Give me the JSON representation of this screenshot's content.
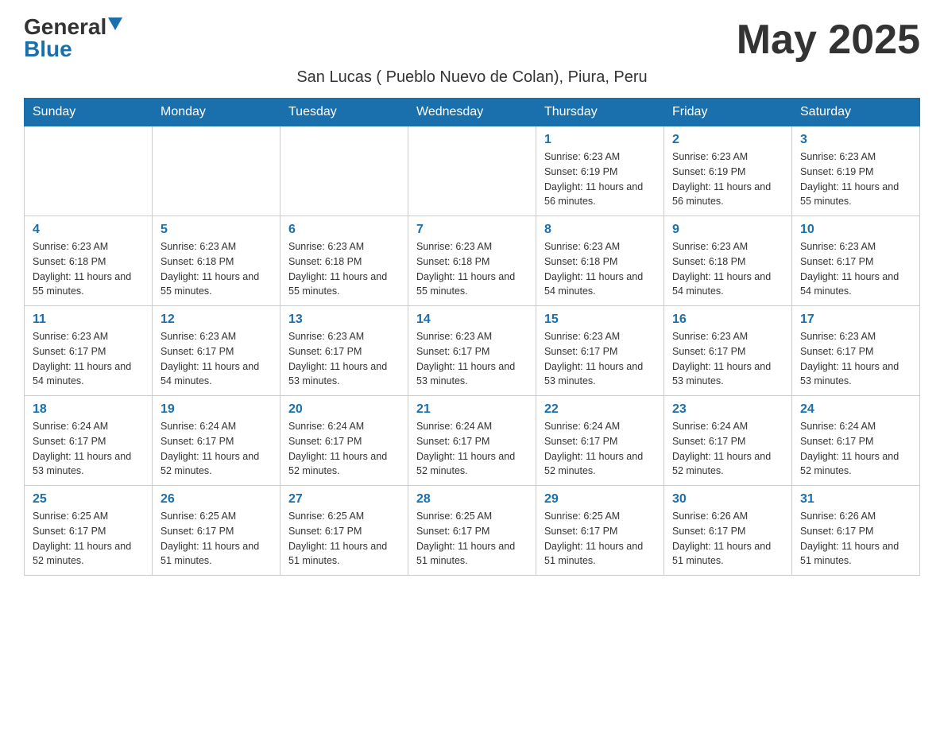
{
  "logo": {
    "general": "General",
    "blue": "Blue"
  },
  "header": {
    "month_year": "May 2025",
    "subtitle": "San Lucas ( Pueblo Nuevo de Colan), Piura, Peru"
  },
  "weekdays": [
    "Sunday",
    "Monday",
    "Tuesday",
    "Wednesday",
    "Thursday",
    "Friday",
    "Saturday"
  ],
  "weeks": [
    [
      {
        "day": "",
        "info": ""
      },
      {
        "day": "",
        "info": ""
      },
      {
        "day": "",
        "info": ""
      },
      {
        "day": "",
        "info": ""
      },
      {
        "day": "1",
        "info": "Sunrise: 6:23 AM\nSunset: 6:19 PM\nDaylight: 11 hours and 56 minutes."
      },
      {
        "day": "2",
        "info": "Sunrise: 6:23 AM\nSunset: 6:19 PM\nDaylight: 11 hours and 56 minutes."
      },
      {
        "day": "3",
        "info": "Sunrise: 6:23 AM\nSunset: 6:19 PM\nDaylight: 11 hours and 55 minutes."
      }
    ],
    [
      {
        "day": "4",
        "info": "Sunrise: 6:23 AM\nSunset: 6:18 PM\nDaylight: 11 hours and 55 minutes."
      },
      {
        "day": "5",
        "info": "Sunrise: 6:23 AM\nSunset: 6:18 PM\nDaylight: 11 hours and 55 minutes."
      },
      {
        "day": "6",
        "info": "Sunrise: 6:23 AM\nSunset: 6:18 PM\nDaylight: 11 hours and 55 minutes."
      },
      {
        "day": "7",
        "info": "Sunrise: 6:23 AM\nSunset: 6:18 PM\nDaylight: 11 hours and 55 minutes."
      },
      {
        "day": "8",
        "info": "Sunrise: 6:23 AM\nSunset: 6:18 PM\nDaylight: 11 hours and 54 minutes."
      },
      {
        "day": "9",
        "info": "Sunrise: 6:23 AM\nSunset: 6:18 PM\nDaylight: 11 hours and 54 minutes."
      },
      {
        "day": "10",
        "info": "Sunrise: 6:23 AM\nSunset: 6:17 PM\nDaylight: 11 hours and 54 minutes."
      }
    ],
    [
      {
        "day": "11",
        "info": "Sunrise: 6:23 AM\nSunset: 6:17 PM\nDaylight: 11 hours and 54 minutes."
      },
      {
        "day": "12",
        "info": "Sunrise: 6:23 AM\nSunset: 6:17 PM\nDaylight: 11 hours and 54 minutes."
      },
      {
        "day": "13",
        "info": "Sunrise: 6:23 AM\nSunset: 6:17 PM\nDaylight: 11 hours and 53 minutes."
      },
      {
        "day": "14",
        "info": "Sunrise: 6:23 AM\nSunset: 6:17 PM\nDaylight: 11 hours and 53 minutes."
      },
      {
        "day": "15",
        "info": "Sunrise: 6:23 AM\nSunset: 6:17 PM\nDaylight: 11 hours and 53 minutes."
      },
      {
        "day": "16",
        "info": "Sunrise: 6:23 AM\nSunset: 6:17 PM\nDaylight: 11 hours and 53 minutes."
      },
      {
        "day": "17",
        "info": "Sunrise: 6:23 AM\nSunset: 6:17 PM\nDaylight: 11 hours and 53 minutes."
      }
    ],
    [
      {
        "day": "18",
        "info": "Sunrise: 6:24 AM\nSunset: 6:17 PM\nDaylight: 11 hours and 53 minutes."
      },
      {
        "day": "19",
        "info": "Sunrise: 6:24 AM\nSunset: 6:17 PM\nDaylight: 11 hours and 52 minutes."
      },
      {
        "day": "20",
        "info": "Sunrise: 6:24 AM\nSunset: 6:17 PM\nDaylight: 11 hours and 52 minutes."
      },
      {
        "day": "21",
        "info": "Sunrise: 6:24 AM\nSunset: 6:17 PM\nDaylight: 11 hours and 52 minutes."
      },
      {
        "day": "22",
        "info": "Sunrise: 6:24 AM\nSunset: 6:17 PM\nDaylight: 11 hours and 52 minutes."
      },
      {
        "day": "23",
        "info": "Sunrise: 6:24 AM\nSunset: 6:17 PM\nDaylight: 11 hours and 52 minutes."
      },
      {
        "day": "24",
        "info": "Sunrise: 6:24 AM\nSunset: 6:17 PM\nDaylight: 11 hours and 52 minutes."
      }
    ],
    [
      {
        "day": "25",
        "info": "Sunrise: 6:25 AM\nSunset: 6:17 PM\nDaylight: 11 hours and 52 minutes."
      },
      {
        "day": "26",
        "info": "Sunrise: 6:25 AM\nSunset: 6:17 PM\nDaylight: 11 hours and 51 minutes."
      },
      {
        "day": "27",
        "info": "Sunrise: 6:25 AM\nSunset: 6:17 PM\nDaylight: 11 hours and 51 minutes."
      },
      {
        "day": "28",
        "info": "Sunrise: 6:25 AM\nSunset: 6:17 PM\nDaylight: 11 hours and 51 minutes."
      },
      {
        "day": "29",
        "info": "Sunrise: 6:25 AM\nSunset: 6:17 PM\nDaylight: 11 hours and 51 minutes."
      },
      {
        "day": "30",
        "info": "Sunrise: 6:26 AM\nSunset: 6:17 PM\nDaylight: 11 hours and 51 minutes."
      },
      {
        "day": "31",
        "info": "Sunrise: 6:26 AM\nSunset: 6:17 PM\nDaylight: 11 hours and 51 minutes."
      }
    ]
  ]
}
